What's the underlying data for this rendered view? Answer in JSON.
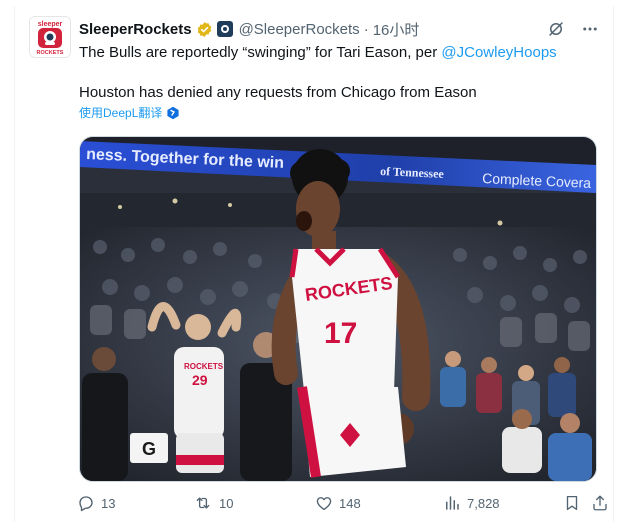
{
  "tweet": {
    "display_name": "SleeperRockets",
    "handle": "@SleeperRockets",
    "separator": "·",
    "time": "16小时",
    "avatar_text_top": "sleeper",
    "avatar_text_bottom": "ROCKETS",
    "line1_text": "The Bulls are reportedly “swinging” for Tari Eason, per ",
    "line1_mention": "@JCowleyHoops",
    "line2_text": "Houston has denied any requests from Chicago from Eason",
    "translate_label": "使用DeepL翻译",
    "media": {
      "arena_banner_left": "ness. Together for the win",
      "arena_banner_mid": "of Tennessee",
      "arena_banner_right": "Complete Covera",
      "jersey_main": "ROCKETS",
      "jersey_number_main": "17",
      "jersey_back_number": "29",
      "jersey_back_text": "ROCKETS",
      "sign_letter": "G"
    }
  },
  "actions": {
    "replies": "13",
    "retweets": "10",
    "likes": "148",
    "views": "7,828"
  },
  "colors": {
    "accent_blue": "#1d9bf0",
    "gray_text": "#536471",
    "verified_gold": "#e2b719",
    "jersey_red": "#ce1141"
  }
}
